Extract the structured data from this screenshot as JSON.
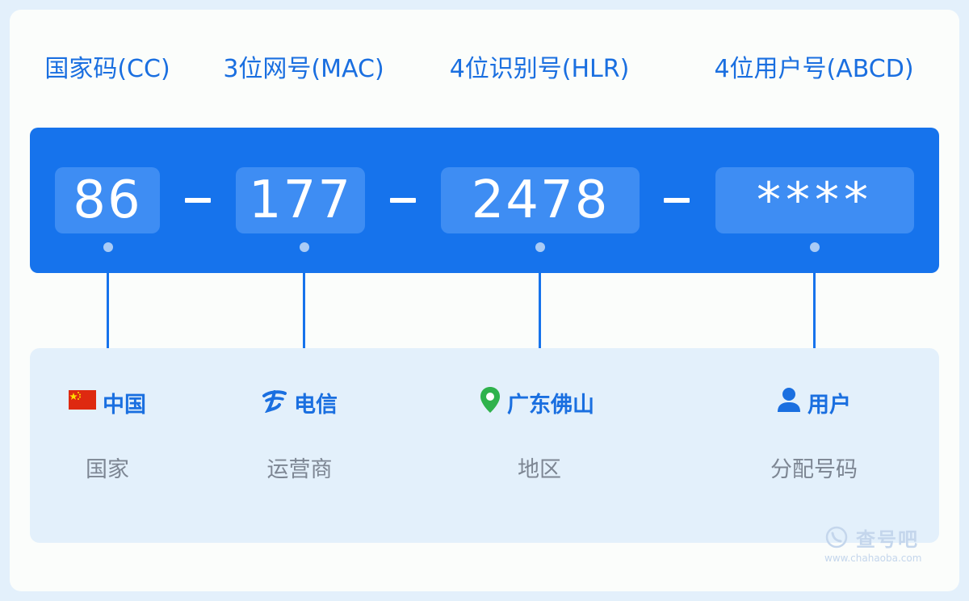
{
  "header": {
    "cc": "国家码(CC)",
    "mac": "3位网号(MAC)",
    "hlr": "4位识别号(HLR)",
    "abcd": "4位用户号(ABCD)"
  },
  "number": {
    "cc": "86",
    "mac": "177",
    "hlr": "2478",
    "abcd": "****"
  },
  "details": {
    "country": {
      "value": "中国",
      "desc": "国家",
      "icon": "china-flag-icon"
    },
    "carrier": {
      "value": "电信",
      "desc": "运营商",
      "icon": "china-telecom-logo-icon"
    },
    "region": {
      "value": "广东佛山",
      "desc": "地区",
      "icon": "location-pin-icon"
    },
    "user": {
      "value": "用户",
      "desc": "分配号码",
      "icon": "user-icon"
    }
  },
  "watermark": {
    "brand": "查号吧",
    "url": "www.chahaoba.com"
  },
  "colors": {
    "accent": "#1673ec",
    "segment": "#3e8df3",
    "panel": "#e3f0fb",
    "pin": "#2fb24c",
    "flag": "#de2910"
  }
}
